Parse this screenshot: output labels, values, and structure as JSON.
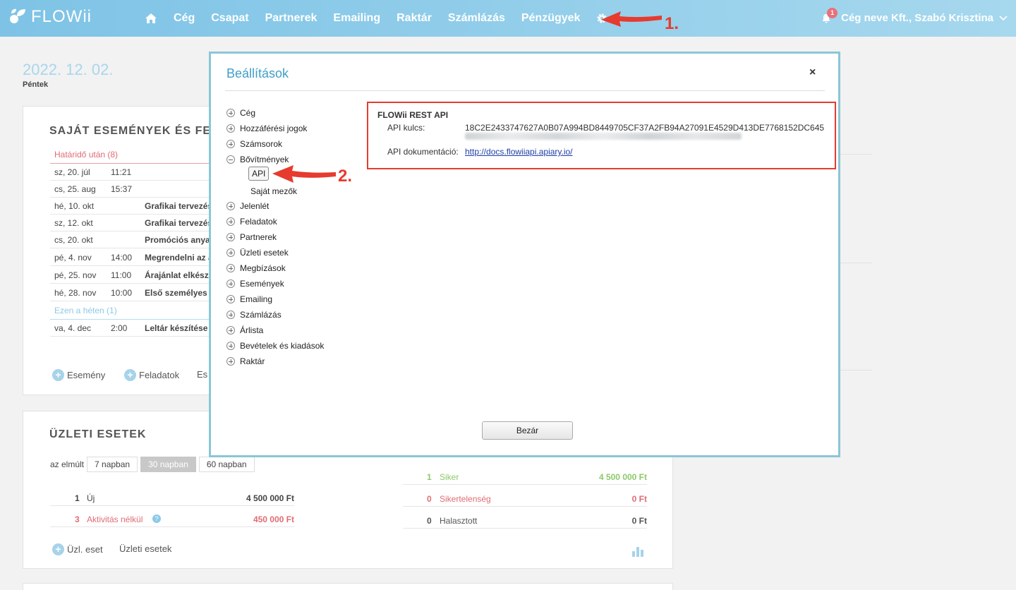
{
  "topbar": {
    "logo": "FLOWii",
    "nav": [
      "Cég",
      "Csapat",
      "Partnerek",
      "Emailing",
      "Raktár",
      "Számlázás",
      "Pénzügyek"
    ],
    "notification_count": "1",
    "user": "Cég neve Kft., Szabó Krisztina"
  },
  "page": {
    "date": "2022. 12. 02.",
    "day": "Péntek"
  },
  "events_panel": {
    "title": "SAJÁT ESEMÉNYEK ÉS FELA",
    "group_overdue": "Határidő után (8)",
    "group_week": "Ezen a héten (1)",
    "rows": [
      {
        "date": "sz, 20. júl",
        "time": "11:21",
        "title": ""
      },
      {
        "date": "cs, 25. aug",
        "time": "15:37",
        "title": ""
      },
      {
        "date": "hé, 10. okt",
        "time": "",
        "title": "Grafikai tervezés"
      },
      {
        "date": "sz, 12. okt",
        "time": "",
        "title": "Grafikai tervezés"
      },
      {
        "date": "cs, 20. okt",
        "time": "",
        "title": "Promóciós anyag"
      },
      {
        "date": "pé, 4. nov",
        "time": "14:00",
        "title": "Megrendelni az a"
      },
      {
        "date": "pé, 25. nov",
        "time": "11:00",
        "title": "Árajánlat elkészí"
      },
      {
        "date": "hé, 28. nov",
        "time": "10:00",
        "title": "Első személyes t"
      }
    ],
    "week_rows": [
      {
        "date": "va, 4. dec",
        "time": "2:00",
        "title": "Leltár készítése"
      }
    ],
    "add_event": "Esemény",
    "add_task": "Feladatok",
    "add_more": "Es"
  },
  "business_panel": {
    "title": "ÜZLETI ESETEK",
    "filter_label": "az elmúlt",
    "filters": [
      "7 napban",
      "30 napban",
      "60 napban"
    ],
    "left_rows": [
      {
        "count": "1",
        "label": "Új",
        "amount": "4 500 000 Ft"
      },
      {
        "count": "3",
        "label": "Aktivitás nélkül",
        "amount": "450 000 Ft"
      }
    ],
    "right_rows": [
      {
        "count": "1",
        "label": "Siker",
        "amount": "4 500 000 Ft"
      },
      {
        "count": "0",
        "label": "Sikertelenség",
        "amount": "0 Ft"
      },
      {
        "count": "0",
        "label": "Halasztott",
        "amount": "0 Ft"
      }
    ],
    "add_case": "Üzl. eset",
    "cases_link": "Üzleti esetek"
  },
  "modal": {
    "title": "Beállítások",
    "close": "×",
    "tree": [
      "Cég",
      "Hozzáférési jogok",
      "Számsorok",
      "Bővítmények"
    ],
    "tree_sub": [
      "API",
      "Saját mezők"
    ],
    "tree_rest": [
      "Jelenlét",
      "Feladatok",
      "Partnerek",
      "Üzleti esetek",
      "Megbízások",
      "Események",
      "Emailing",
      "Számlázás",
      "Árlista",
      "Bevételek és kiadások",
      "Raktár"
    ],
    "api_heading": "FLOWii REST API",
    "api_key_label": "API kulcs:",
    "api_key_value": "18C2E2433747627A0B07A994BD8449705CF37A2FB94A27091E4529D413DE7768152DC645",
    "api_doc_label": "API dokumentáció:",
    "api_doc_link": "http://docs.flowiiapi.apiary.io/",
    "close_button": "Bezár"
  },
  "annotations": {
    "step1": "1.",
    "step2": "2."
  },
  "colors": {
    "topbar": "#7ec3e6",
    "accent": "#3f9fc7",
    "annotation_red": "#e63b2e",
    "overdue": "#e06c75",
    "success": "#8cc96b"
  }
}
